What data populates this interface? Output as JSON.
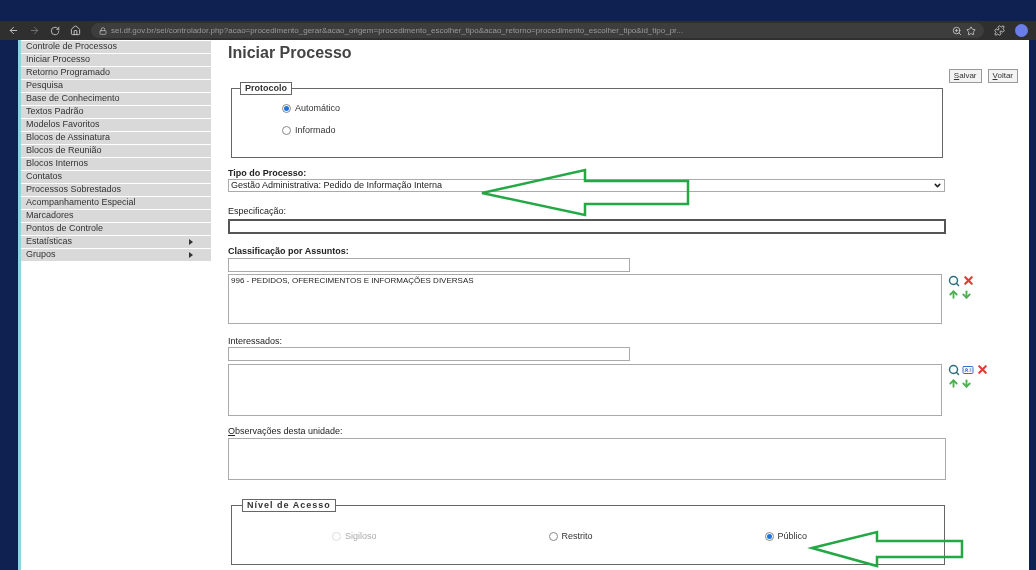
{
  "browser": {
    "url": "sei.df.gov.br/sei/controlador.php?acao=procedimento_gerar&acao_origem=procedimento_escolher_tipo&acao_retorno=procedimento_escolher_tipo&id_tipo_pr..."
  },
  "sidebar": {
    "items": [
      {
        "label": "Controle de Processos",
        "has_submenu": false
      },
      {
        "label": "Iniciar Processo",
        "has_submenu": false
      },
      {
        "label": "Retorno Programado",
        "has_submenu": false
      },
      {
        "label": "Pesquisa",
        "has_submenu": false
      },
      {
        "label": "Base de Conhecimento",
        "has_submenu": false
      },
      {
        "label": "Textos Padrão",
        "has_submenu": false
      },
      {
        "label": "Modelos Favoritos",
        "has_submenu": false
      },
      {
        "label": "Blocos de Assinatura",
        "has_submenu": false
      },
      {
        "label": "Blocos de Reunião",
        "has_submenu": false
      },
      {
        "label": "Blocos Internos",
        "has_submenu": false
      },
      {
        "label": "Contatos",
        "has_submenu": false
      },
      {
        "label": "Processos Sobrestados",
        "has_submenu": false
      },
      {
        "label": "Acompanhamento Especial",
        "has_submenu": false
      },
      {
        "label": "Marcadores",
        "has_submenu": false
      },
      {
        "label": "Pontos de Controle",
        "has_submenu": false
      },
      {
        "label": "Estatísticas",
        "has_submenu": true
      },
      {
        "label": "Grupos",
        "has_submenu": true
      }
    ]
  },
  "page": {
    "title": "Iniciar Processo",
    "buttons": [
      "Salvar",
      "Voltar"
    ]
  },
  "protocolo": {
    "legend": "Protocolo",
    "options": [
      {
        "label": "Automático",
        "selected": true
      },
      {
        "label": "Informado",
        "selected": false
      }
    ]
  },
  "tipo_processo": {
    "label": "Tipo do Processo:",
    "value": "Gestão Administrativa: Pedido de Informação Interna"
  },
  "especificacao": {
    "label": "Especificação:"
  },
  "classificacao": {
    "label": "Classificação por Assuntos:",
    "items": [
      "996 - PEDIDOS, OFERECIMENTOS E INFORMAÇÕES DIVERSAS"
    ]
  },
  "interessados": {
    "label": "Interessados:"
  },
  "observacoes": {
    "label": "Observações desta unidade:"
  },
  "nivel_acesso": {
    "legend": "Nível de Acesso",
    "options": [
      {
        "label": "Sigiloso",
        "selected": false,
        "disabled": true
      },
      {
        "label": "Restrito",
        "selected": false,
        "disabled": false
      },
      {
        "label": "Público",
        "selected": true,
        "disabled": false
      }
    ]
  }
}
